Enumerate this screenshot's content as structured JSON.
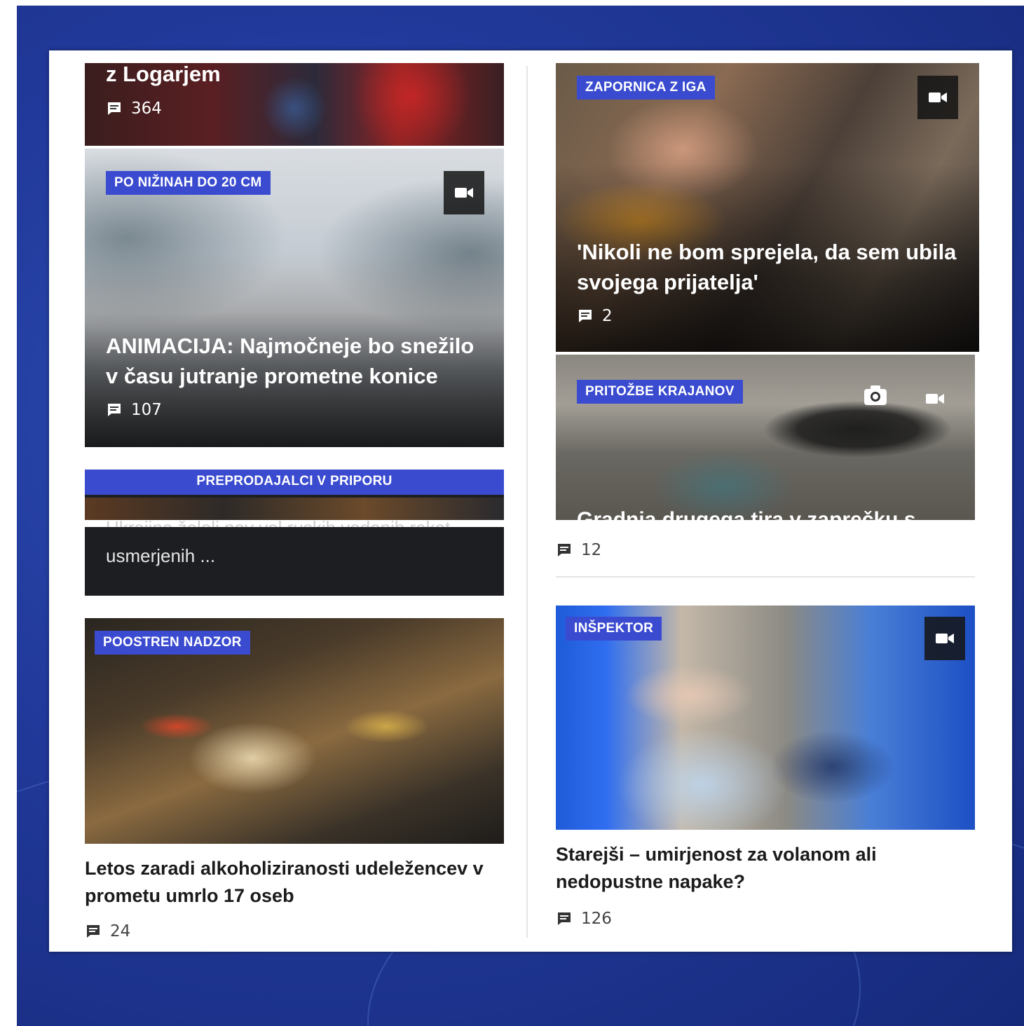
{
  "articles": {
    "a1": {
      "title": "z Logarjem",
      "comments": "364"
    },
    "a2": {
      "tag": "PO NIŽINAH DO 20 CM",
      "title": "ANIMACIJA: Najmočneje bo snežilo v času jutranje prometne konice",
      "comments": "107"
    },
    "a3": {
      "tag": "PREPRODAJALCI V PRIPORU",
      "title_partial": "Ukrajino želeli nov val ruskih vodenih raket,",
      "title_end": "usmerjenih ..."
    },
    "a4": {
      "tag": "POOSTREN NADZOR",
      "title": "Letos zaradi alkoholiziranosti udeležencev v prometu umrlo 17 oseb",
      "comments": "24"
    },
    "a5": {
      "tag": "ZAPORNICA Z IGA",
      "title": "'Nikoli ne bom sprejela, da sem ubila svojega prijatelja'",
      "comments": "2"
    },
    "a6": {
      "tag": "PRITOŽBE KRAJANOV",
      "title_partial": "Gradnja drugega tira v zaprečku s",
      "comments": "12"
    },
    "a7": {
      "tag": "INŠPEKTOR",
      "title": "Starejši – umirjenost za volanom ali nedopustne napake?",
      "comments": "126"
    }
  },
  "icons": {
    "comment": "comment-icon",
    "video": "video-icon",
    "camera": "camera-icon"
  },
  "colors": {
    "tag_bg": "#3a4bd0",
    "page_bg": "#21399a"
  }
}
